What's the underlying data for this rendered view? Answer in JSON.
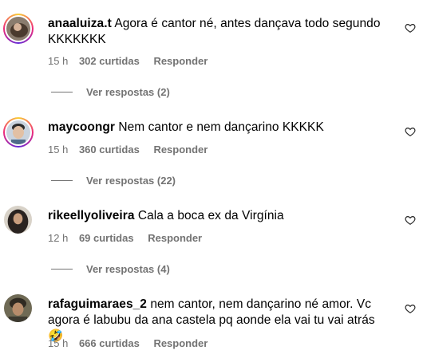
{
  "comments": [
    {
      "username": "anaaluiza.t",
      "text": "Agora é cantor né, antes dançava todo segundo KKKKKKK",
      "time": "15 h",
      "likes": "302 curtidas",
      "reply_label": "Responder",
      "view_replies": "Ver respostas (2)",
      "avatar_icon": "avatar-ring-icon",
      "like_icon": "heart-outline-icon"
    },
    {
      "username": "maycoongr",
      "text": "Nem cantor e nem dançarino KKKKK",
      "time": "15 h",
      "likes": "360 curtidas",
      "reply_label": "Responder",
      "view_replies": "Ver respostas (22)",
      "avatar_icon": "avatar-ring-icon",
      "like_icon": "heart-outline-icon"
    },
    {
      "username": "rikeellyoliveira",
      "text": "Cala a boca ex da Virgínia",
      "time": "12 h",
      "likes": "69 curtidas",
      "reply_label": "Responder",
      "view_replies": "Ver respostas (4)",
      "avatar_icon": "avatar-icon",
      "like_icon": "heart-outline-icon"
    },
    {
      "username": "rafaguimaraes_2",
      "text": "nem cantor, nem dançarino né amor. Vc agora é labubu da ana castela pq aonde ela vai tu vai atrás 🤣",
      "time": "15 h",
      "likes": "666 curtidas",
      "reply_label": "Responder",
      "avatar_icon": "avatar-icon",
      "like_icon": "heart-outline-icon"
    }
  ],
  "colors": {
    "secondary_text": "#737373",
    "story_ring": [
      "#f9ce34",
      "#ee2a7b",
      "#6228d7"
    ]
  }
}
